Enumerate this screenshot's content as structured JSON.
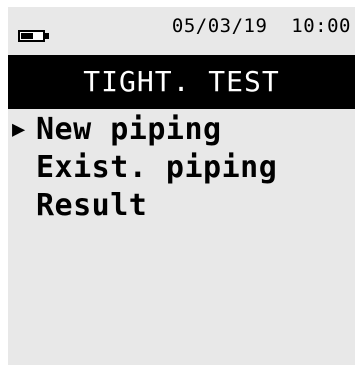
{
  "status": {
    "date": "05/03/19",
    "time": "10:00",
    "battery_level": 0.55
  },
  "title": "TIGHT. TEST",
  "menu": {
    "selected_marker": "▶",
    "selected_index": 0,
    "items": [
      {
        "label": "New piping"
      },
      {
        "label": "Exist. piping"
      },
      {
        "label": "Result"
      }
    ]
  }
}
